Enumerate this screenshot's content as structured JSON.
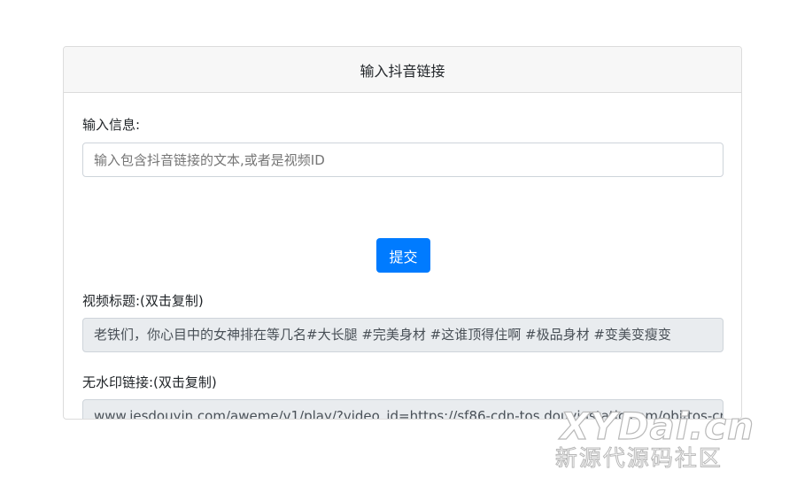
{
  "card": {
    "header_title": "输入抖音链接"
  },
  "input_section": {
    "label": "输入信息:",
    "placeholder": "输入包含抖音链接的文本,或者是视频ID",
    "value": ""
  },
  "submit": {
    "label": "提交"
  },
  "title_section": {
    "label": "视频标题:(双击复制)",
    "value": "老铁们，你心目中的女神排在等几名#大长腿 #完美身材 #这谁顶得住啊 #极品身材 #变美变瘦变"
  },
  "link_section": {
    "label": "无水印链接:(双击复制)",
    "value": "www.iesdouyin.com/aweme/v1/play/?video_id=https://sf86-cdn-tos.douyinstatic.com/obj/tos-cn"
  },
  "watermark": {
    "logo": "XYDai.cn",
    "subtitle": "新源代源码社区"
  },
  "colors": {
    "primary": "#007bff",
    "readonly_bg": "#e9ecef",
    "header_bg": "#f7f7f7"
  }
}
